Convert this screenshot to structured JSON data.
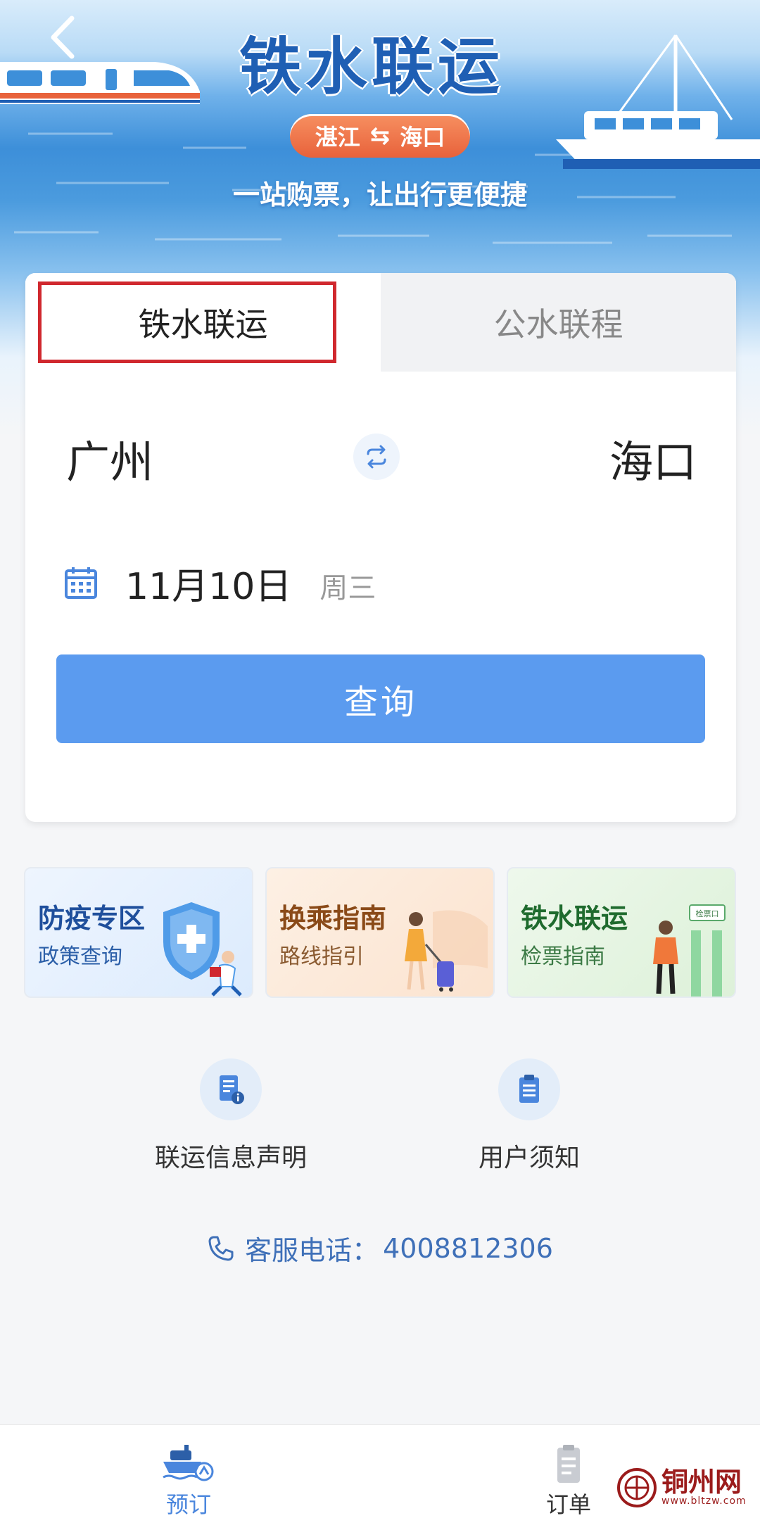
{
  "banner": {
    "title": "铁水联运",
    "route": {
      "from": "湛江",
      "swap_glyph": "⇆",
      "to": "海口"
    },
    "slogan": "一站购票，让出行更便捷"
  },
  "booking": {
    "tabs": [
      {
        "label": "铁水联运",
        "active": true
      },
      {
        "label": "公水联程",
        "active": false
      }
    ],
    "from_city": "广州",
    "to_city": "海口",
    "date": "11月10日",
    "weekday": "周三",
    "search_label": "查询"
  },
  "services": [
    {
      "title": "防疫专区",
      "subtitle": "政策查询"
    },
    {
      "title": "换乘指南",
      "subtitle": "路线指引"
    },
    {
      "title": "铁水联运",
      "subtitle": "检票指南",
      "illustration_sign": "检票口"
    }
  ],
  "info_links": [
    {
      "label": "联运信息声明",
      "icon": "document-info-icon"
    },
    {
      "label": "用户须知",
      "icon": "notice-icon"
    }
  ],
  "hotline": {
    "label": "客服电话：",
    "number": "4008812306"
  },
  "tabbar": [
    {
      "label": "预订",
      "icon": "train-ship-icon",
      "active": true
    },
    {
      "label": "订单",
      "icon": "clipboard-icon",
      "active": false
    }
  ],
  "watermark": {
    "name": "铜州网",
    "url": "www.bltzw.com"
  },
  "colors": {
    "primary_button": "#5b9bef",
    "banner_title": "#1f5fb4",
    "route_pill": "#e8623b",
    "tab_highlight_border": "#d0282e",
    "hotline": "#3f70b8"
  }
}
